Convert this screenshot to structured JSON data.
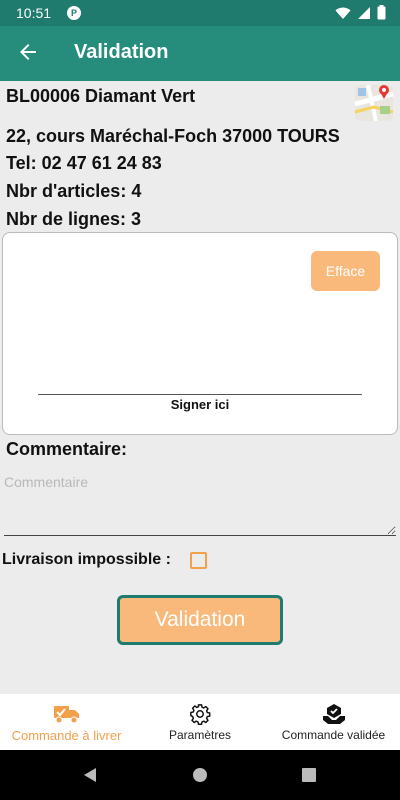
{
  "statusbar": {
    "time": "10:51",
    "app_badge": "P"
  },
  "appbar": {
    "title": "Validation"
  },
  "order": {
    "reference": "BL00006 Diamant Vert",
    "address": "22, cours Maréchal-Foch 37000 TOURS",
    "phone": "Tel: 02 47 61 24 83",
    "articles": "Nbr d'articles: 4",
    "lines": "Nbr de lignes: 3"
  },
  "signature": {
    "clear_label": "Efface",
    "sign_here": "Signer ici"
  },
  "comment": {
    "title": "Commentaire:",
    "placeholder": "Commentaire",
    "value": ""
  },
  "delivery": {
    "impossible_label": "Livraison impossible :",
    "impossible_checked": false
  },
  "validate_label": "Validation",
  "bottomnav": {
    "items": [
      {
        "label": "Commande à livrer",
        "icon": "delivery-truck-icon",
        "active": true
      },
      {
        "label": "Paramètres",
        "icon": "gear-icon",
        "active": false
      },
      {
        "label": "Commande validée",
        "icon": "validated-order-icon",
        "active": false
      }
    ]
  },
  "colors": {
    "primary": "#268d7d",
    "statusbar": "#1e7b6e",
    "accent": "#f9b97a",
    "accent_text": "#f3a04a"
  }
}
